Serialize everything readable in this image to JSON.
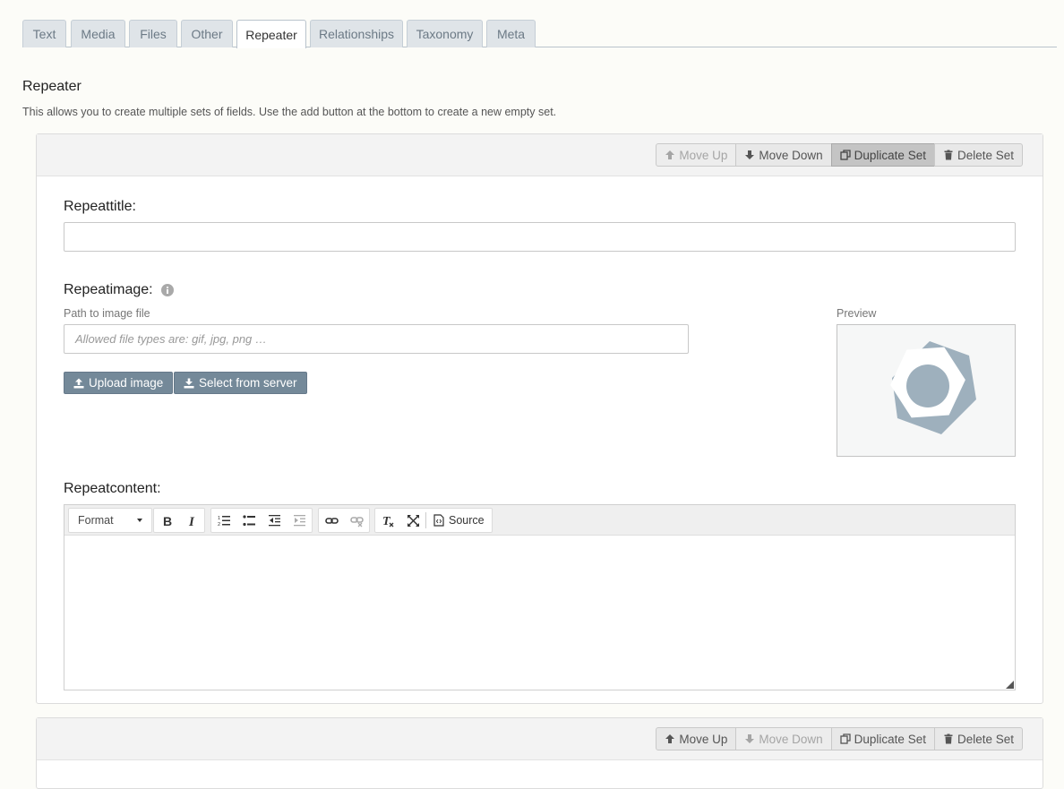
{
  "tabs": [
    {
      "label": "Text"
    },
    {
      "label": "Media"
    },
    {
      "label": "Files"
    },
    {
      "label": "Other"
    },
    {
      "label": "Repeater"
    },
    {
      "label": "Relationships"
    },
    {
      "label": "Taxonomy"
    },
    {
      "label": "Meta"
    }
  ],
  "active_tab": "Repeater",
  "section": {
    "title": "Repeater",
    "description": "This allows you to create multiple sets of fields. Use the add button at the bottom to create a new empty set."
  },
  "set_actions": {
    "move_up": "Move Up",
    "move_down": "Move Down",
    "duplicate": "Duplicate Set",
    "delete": "Delete Set"
  },
  "fields": {
    "title_label": "Repeattitle:",
    "title_value": "",
    "image_label": "Repeatimage:",
    "image_path_label": "Path to image file",
    "image_placeholder": "Allowed file types are: gif, jpg, png …",
    "preview_label": "Preview",
    "upload_button": "Upload image",
    "select_button": "Select from server",
    "content_label": "Repeatcontent:"
  },
  "editor": {
    "format_label": "Format",
    "source_label": "Source"
  },
  "colors": {
    "tab_bg": "#dfe4e8",
    "primary_button": "#748999",
    "logo_fill": "#9eb0bd"
  }
}
